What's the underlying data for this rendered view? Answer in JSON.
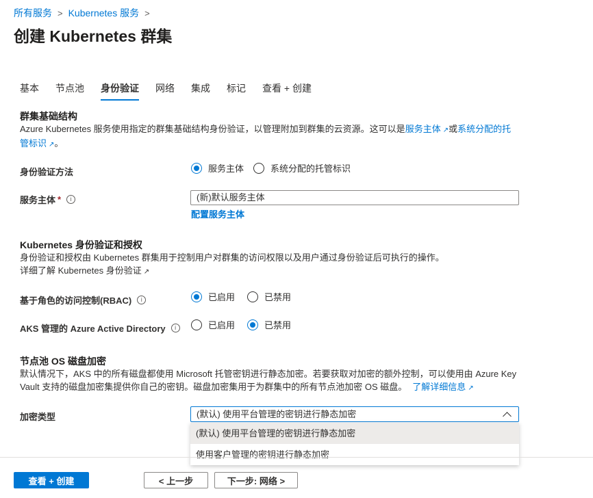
{
  "breadcrumb": {
    "item1": "所有服务",
    "item2": "Kubernetes 服务",
    "sep": ">"
  },
  "page_title": "创建 Kubernetes 群集",
  "tabs": [
    {
      "label": "基本",
      "active": false
    },
    {
      "label": "节点池",
      "active": false
    },
    {
      "label": "身份验证",
      "active": true
    },
    {
      "label": "网络",
      "active": false
    },
    {
      "label": "集成",
      "active": false
    },
    {
      "label": "标记",
      "active": false
    },
    {
      "label": "查看 + 创建",
      "active": false
    }
  ],
  "cluster_infra": {
    "title": "群集基础结构",
    "desc_prefix": "Azure Kubernetes 服务使用指定的群集基础结构身份验证，以管理附加到群集的云资源。这可以是",
    "link1": "服务主体",
    "or": "或",
    "link2_line1": "系统分配的托",
    "link2_line2": "管标识",
    "desc_suffix": "。"
  },
  "auth_method": {
    "label": "身份验证方法",
    "option1": "服务主体",
    "option2": "系统分配的托管标识",
    "selected": "服务主体"
  },
  "service_principal": {
    "label": "服务主体",
    "required_mark": "*",
    "value": "(新)默认服务主体",
    "configure_link": "配置服务主体"
  },
  "k8s_auth": {
    "title": "Kubernetes 身份验证和授权",
    "desc": "身份验证和授权由 Kubernetes 群集用于控制用户对群集的访问权限以及用户通过身份验证后可执行的操作。",
    "learn_link": "详细了解 Kubernetes 身份验证"
  },
  "rbac": {
    "label": "基于角色的访问控制(RBAC)",
    "option1": "已启用",
    "option2": "已禁用",
    "selected": "已启用"
  },
  "aad": {
    "label": "AKS 管理的 Azure Active Directory",
    "option1": "已启用",
    "option2": "已禁用",
    "selected": "已禁用"
  },
  "os_disk": {
    "title": "节点池 OS 磁盘加密",
    "desc_line1": "默认情况下，AKS 中的所有磁盘都使用 Microsoft 托管密钥进行静态加密。若要获取对加密的额外控制，可以使用由 Azure Key",
    "desc_line2": "Vault 支持的磁盘加密集提供你自己的密钥。磁盘加密集用于为群集中的所有节点池加密 OS 磁盘。",
    "learn_link": "了解详细信息"
  },
  "encryption_type": {
    "label": "加密类型",
    "selected": "(默认) 使用平台管理的密钥进行静态加密",
    "options": [
      "(默认) 使用平台管理的密钥进行静态加密",
      "使用客户管理的密钥进行静态加密"
    ]
  },
  "footer": {
    "review_create": "查看 + 创建",
    "previous": "< 上一步",
    "next": "下一步: 网络 >"
  },
  "icons": {
    "info": "info-icon",
    "external": "external-link-icon"
  },
  "colors": {
    "accent": "#0078d4",
    "required": "#a4262c",
    "text": "#323130"
  }
}
